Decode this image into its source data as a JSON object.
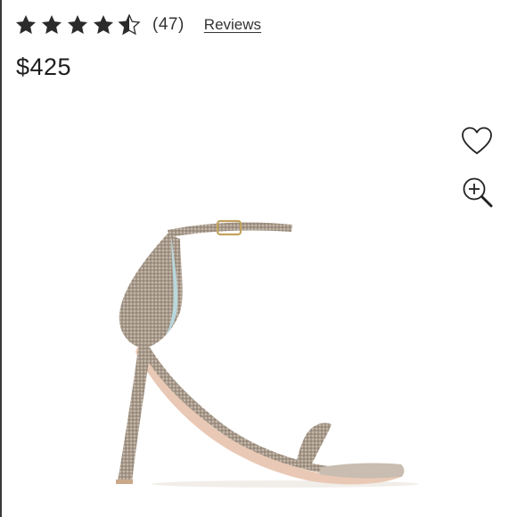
{
  "rating": {
    "value": 4.5,
    "max": 5,
    "count_text": "(47)",
    "reviews_link": "Reviews",
    "star_color": "#2b2b2b"
  },
  "price": "$425",
  "actions": {
    "wishlist_icon": "heart-outline-icon",
    "zoom_icon": "zoom-in-icon"
  },
  "product": {
    "image_subject": "strappy metallic high-heel sandal",
    "colors": {
      "glitter": "#a7998a",
      "sole": "#e9c9b5",
      "lining": "#b9d7dc"
    }
  }
}
